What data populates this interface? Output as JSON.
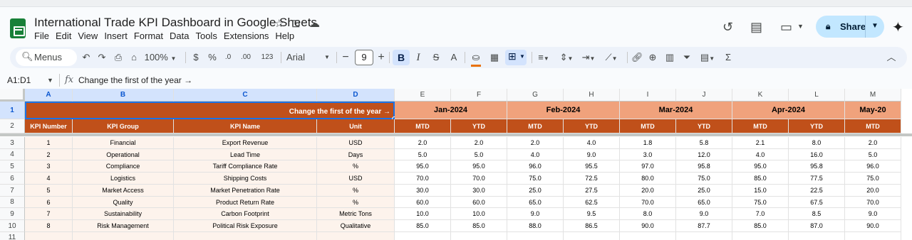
{
  "app": {
    "title": "International Trade KPI Dashboard in Google Sheets",
    "menus": [
      "File",
      "Edit",
      "View",
      "Insert",
      "Format",
      "Data",
      "Tools",
      "Extensions",
      "Help"
    ],
    "share_label": "Share",
    "brand_color": "#188038"
  },
  "toolbar": {
    "menus_label": "Menus",
    "zoom": "100%",
    "currency": "$",
    "percent": "%",
    "decrease_decimal": ".0",
    "increase_decimal": ".00",
    "number_format": "123",
    "font": "Arial",
    "font_size": "9",
    "minus": "−",
    "plus": "+",
    "bold": "B",
    "italic": "I",
    "strike": "S",
    "text_color_glyph": "A",
    "fill_color": "#e8710a",
    "text_color": "#000000"
  },
  "formula_bar": {
    "name_box": "A1:D1",
    "fx": "fx",
    "content": "Change the first of the year →"
  },
  "sheet": {
    "header_color": "#c0501a",
    "month_color": "#f0a27c",
    "cell_color": "#fdf3ec",
    "col_letters": [
      "A",
      "B",
      "C",
      "D",
      "E",
      "F",
      "G",
      "H",
      "I",
      "J",
      "K",
      "L",
      "M"
    ],
    "row_numbers": [
      "1",
      "2",
      "3",
      "4",
      "5",
      "6",
      "7",
      "8",
      "9",
      "10",
      "11"
    ],
    "banner": "Change the first of the year →",
    "months": [
      "Jan-2024",
      "Feb-2024",
      "Mar-2024",
      "Apr-2024",
      "May-20"
    ],
    "headers": [
      "KPI Number",
      "KPI Group",
      "KPI Name",
      "Unit"
    ],
    "sub_headers": [
      "MTD",
      "YTD",
      "MTD",
      "YTD",
      "MTD",
      "YTD",
      "MTD",
      "YTD",
      "MTD"
    ],
    "rows": [
      [
        "1",
        "Financial",
        "Export Revenue",
        "USD",
        "2.0",
        "2.0",
        "2.0",
        "4.0",
        "1.8",
        "5.8",
        "2.1",
        "8.0",
        "2.0"
      ],
      [
        "2",
        "Operational",
        "Lead Time",
        "Days",
        "5.0",
        "5.0",
        "4.0",
        "9.0",
        "3.0",
        "12.0",
        "4.0",
        "16.0",
        "5.0"
      ],
      [
        "3",
        "Compliance",
        "Tariff Compliance Rate",
        "%",
        "95.0",
        "95.0",
        "96.0",
        "95.5",
        "97.0",
        "95.8",
        "95.0",
        "95.8",
        "96.0"
      ],
      [
        "4",
        "Logistics",
        "Shipping Costs",
        "USD",
        "70.0",
        "70.0",
        "75.0",
        "72.5",
        "80.0",
        "75.0",
        "85.0",
        "77.5",
        "75.0"
      ],
      [
        "5",
        "Market Access",
        "Market Penetration Rate",
        "%",
        "30.0",
        "30.0",
        "25.0",
        "27.5",
        "20.0",
        "25.0",
        "15.0",
        "22.5",
        "20.0"
      ],
      [
        "6",
        "Quality",
        "Product Return Rate",
        "%",
        "60.0",
        "60.0",
        "65.0",
        "62.5",
        "70.0",
        "65.0",
        "75.0",
        "67.5",
        "70.0"
      ],
      [
        "7",
        "Sustainability",
        "Carbon Footprint",
        "Metric Tons",
        "10.0",
        "10.0",
        "9.0",
        "9.5",
        "8.0",
        "9.0",
        "7.0",
        "8.5",
        "9.0"
      ],
      [
        "8",
        "Risk Management",
        "Political Risk Exposure",
        "Qualitative",
        "85.0",
        "85.0",
        "88.0",
        "86.5",
        "90.0",
        "87.7",
        "85.0",
        "87.0",
        "90.0"
      ]
    ]
  }
}
